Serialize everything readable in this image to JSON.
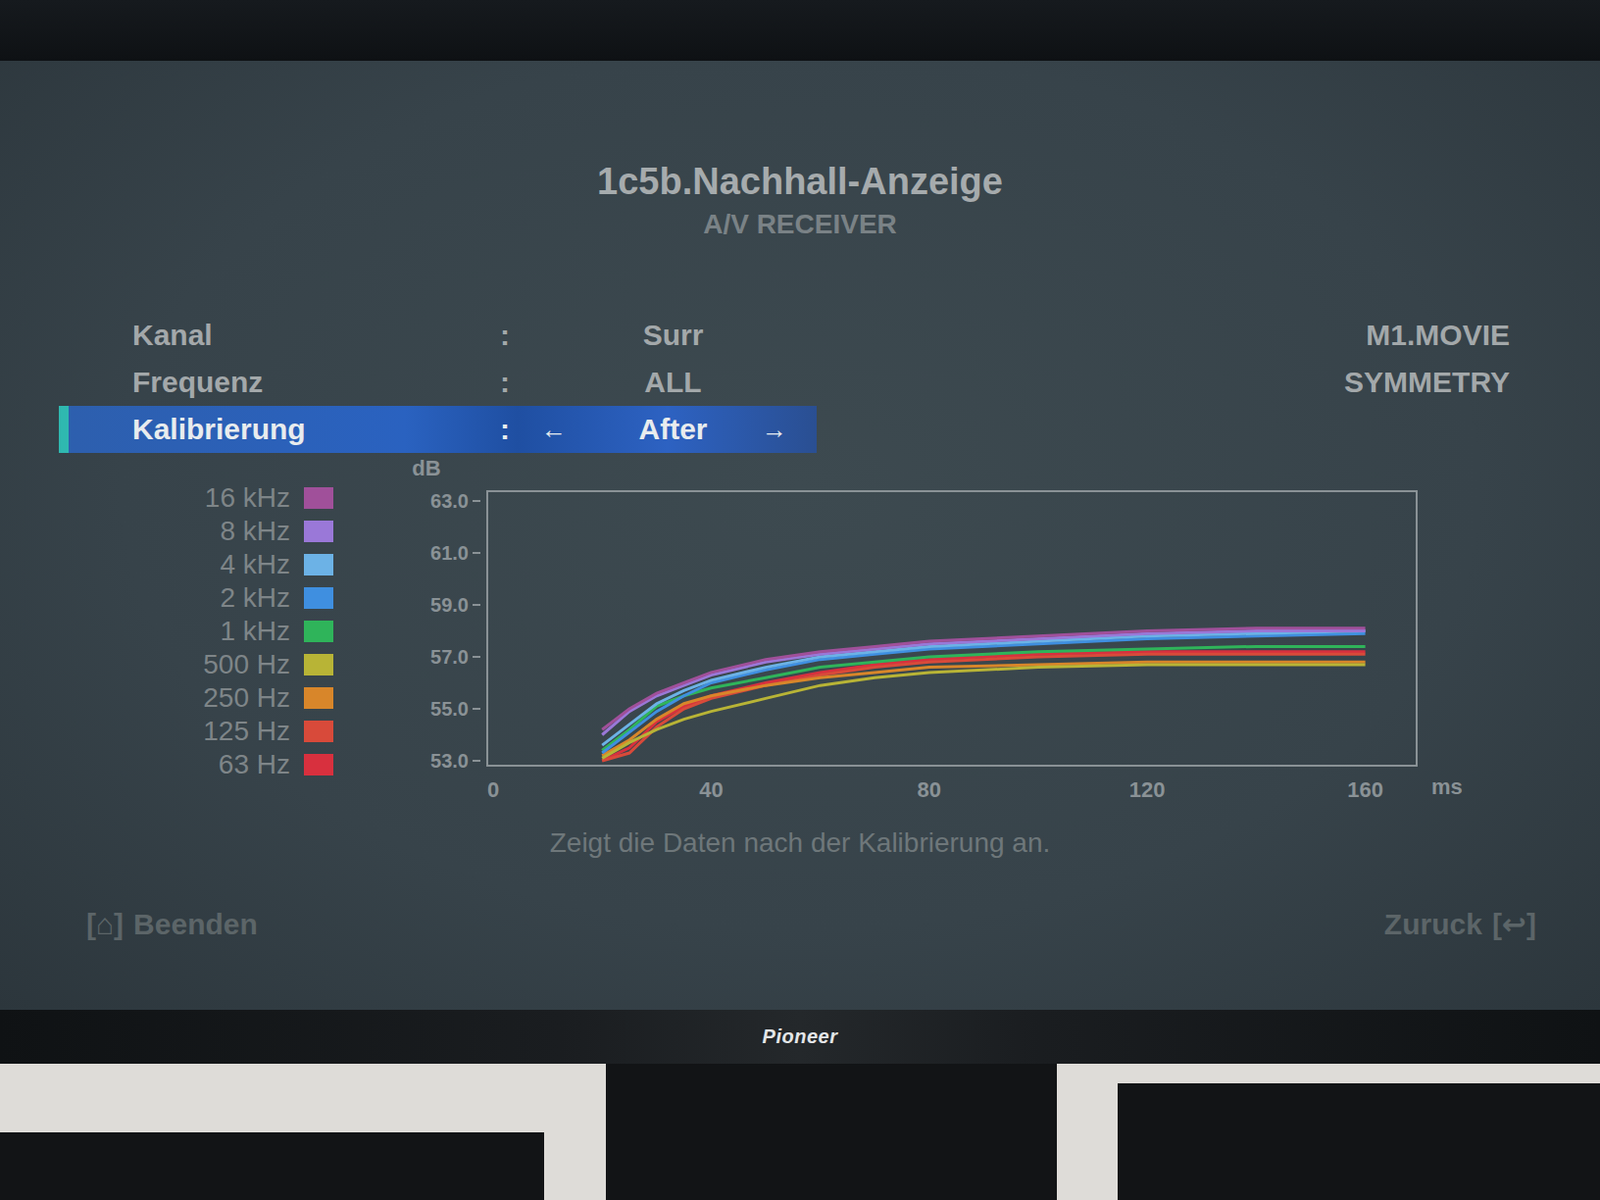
{
  "screen": {
    "title": "1c5b.Nachhall-Anzeige",
    "subtitle": "A/V RECEIVER"
  },
  "settings": [
    {
      "label": "Kanal",
      "separator": ":",
      "value": "Surr",
      "selected": false,
      "arrows": []
    },
    {
      "label": "Frequenz",
      "separator": ":",
      "value": "ALL",
      "selected": false,
      "arrows": []
    },
    {
      "label": "Kalibrierung",
      "separator": ":",
      "value": "After",
      "selected": true,
      "arrows": [
        "←",
        "→"
      ]
    }
  ],
  "mode": [
    "M1.MOVIE",
    "SYMMETRY"
  ],
  "chart": {
    "y_unit": "dB",
    "x_unit": "ms",
    "y_ticks": [
      "63.0",
      "61.0",
      "59.0",
      "57.0",
      "55.0",
      "53.0"
    ],
    "x_ticks": [
      "0",
      "40",
      "80",
      "120",
      "160"
    ],
    "times": [
      20,
      25,
      30,
      35,
      40,
      50,
      60,
      70,
      80,
      100,
      120,
      140,
      160
    ],
    "series": [
      {
        "name": "16 kHz",
        "color": "#a0509a",
        "values": [
          54.2,
          55.0,
          55.6,
          56.0,
          56.4,
          56.9,
          57.2,
          57.4,
          57.6,
          57.8,
          58.0,
          58.1,
          58.1
        ]
      },
      {
        "name": "8 kHz",
        "color": "#9a78d8",
        "values": [
          54.0,
          54.9,
          55.5,
          55.9,
          56.3,
          56.8,
          57.1,
          57.3,
          57.5,
          57.7,
          57.9,
          58.0,
          58.0
        ]
      },
      {
        "name": "4 kHz",
        "color": "#6cb2e6",
        "values": [
          53.6,
          54.4,
          55.2,
          55.7,
          56.1,
          56.6,
          57.0,
          57.2,
          57.4,
          57.6,
          57.8,
          57.9,
          58.0
        ]
      },
      {
        "name": "2 kHz",
        "color": "#3f8fe0",
        "values": [
          53.3,
          54.1,
          54.9,
          55.5,
          56.0,
          56.5,
          56.9,
          57.1,
          57.3,
          57.5,
          57.7,
          57.8,
          57.9
        ]
      },
      {
        "name": "1 kHz",
        "color": "#2fb45a",
        "values": [
          53.4,
          54.2,
          55.1,
          55.5,
          55.8,
          56.2,
          56.6,
          56.8,
          57.0,
          57.2,
          57.3,
          57.4,
          57.4
        ]
      },
      {
        "name": "500 Hz",
        "color": "#b8b436",
        "values": [
          53.1,
          53.7,
          54.2,
          54.6,
          54.9,
          55.4,
          55.9,
          56.2,
          56.4,
          56.6,
          56.7,
          56.7,
          56.7
        ]
      },
      {
        "name": "250 Hz",
        "color": "#d8862a",
        "values": [
          53.2,
          53.8,
          54.6,
          55.2,
          55.5,
          55.9,
          56.2,
          56.4,
          56.6,
          56.7,
          56.8,
          56.8,
          56.8
        ]
      },
      {
        "name": "125 Hz",
        "color": "#d84a3a",
        "values": [
          53.0,
          53.3,
          54.3,
          55.0,
          55.4,
          55.9,
          56.3,
          56.6,
          56.8,
          57.0,
          57.1,
          57.1,
          57.1
        ]
      },
      {
        "name": "63 Hz",
        "color": "#d8303e",
        "values": [
          53.0,
          53.5,
          54.5,
          55.1,
          55.5,
          56.0,
          56.4,
          56.7,
          56.9,
          57.1,
          57.2,
          57.2,
          57.2
        ]
      }
    ]
  },
  "caption": "Zeigt die Daten nach der Kalibrierung an.",
  "footer": {
    "exit": {
      "key": "[⌂]",
      "label": "Beenden"
    },
    "back": {
      "label": "Zuruck",
      "key": "[↩]"
    }
  },
  "tv": {
    "brand": "Pioneer"
  }
}
